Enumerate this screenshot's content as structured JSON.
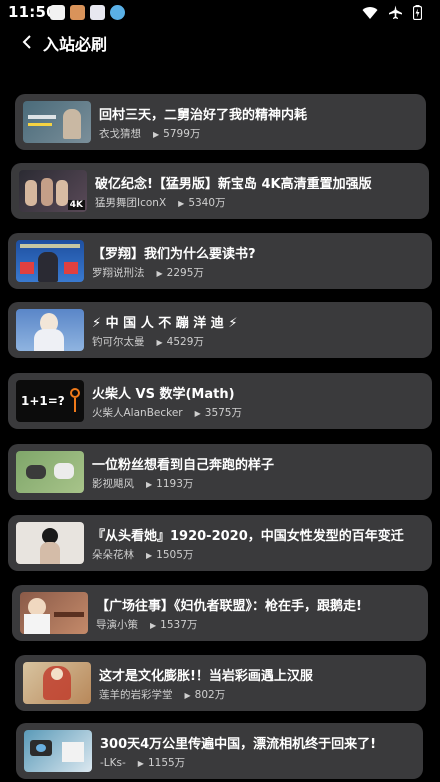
{
  "status": {
    "time": "11:50"
  },
  "header": {
    "title": "入站必刷"
  },
  "videos": [
    {
      "title": "回村三天，二舅治好了我的精神内耗",
      "author": "衣戈猜想",
      "views": "5799万"
    },
    {
      "title": "破亿纪念!【猛男版】新宝岛 4K高清重置加强版",
      "author": "猛男舞团IconX",
      "views": "5340万"
    },
    {
      "title": "【罗翔】我们为什么要读书?",
      "author": "罗翔说刑法",
      "views": "2295万"
    },
    {
      "title": "⚡ 中 国 人 不 蹦 洋 迪 ⚡",
      "author": "钓可尔太曼",
      "views": "4529万"
    },
    {
      "title": "火柴人 VS 数学(Math)",
      "author": "火柴人AlanBecker",
      "views": "3575万"
    },
    {
      "title": "一位粉丝想看到自己奔跑的样子",
      "author": "影视飓风",
      "views": "1193万"
    },
    {
      "title": "『从头看她』1920-2020，中国女性发型的百年变迁",
      "author": "朵朵花林",
      "views": "1505万"
    },
    {
      "title": "【广场往事】《妇仇者联盟》：枪在手，跟鹅走!",
      "author": "导演小策",
      "views": "1537万"
    },
    {
      "title": "这才是文化膨胀!！当岩彩画遇上汉服",
      "author": "莲羊的岩彩学堂",
      "views": "802万"
    },
    {
      "title": "300天4万公里传遍中国，漂流相机终于回来了!",
      "author": "-LKs-",
      "views": "1155万"
    }
  ]
}
